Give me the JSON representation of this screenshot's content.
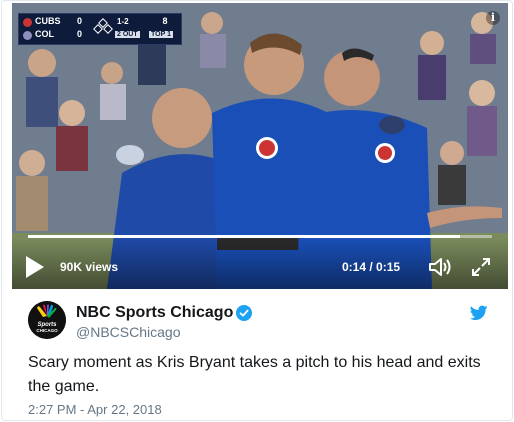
{
  "video": {
    "scorebug": {
      "away_team": "CUBS",
      "away_score": "0",
      "home_team": "COL",
      "home_score": "0",
      "count": "1-2",
      "outs": "2 OUT",
      "pitches": "8",
      "inning": "TOP 1",
      "away_color": "#cc3433",
      "home_color": "#8f8fbf"
    },
    "views": "90K views",
    "time": "0:14 / 0:15",
    "progress_fraction": 0.93,
    "icons": [
      "info-icon",
      "play-icon",
      "volume-icon",
      "fullscreen-icon"
    ]
  },
  "author": {
    "name": "NBC Sports Chicago",
    "handle": "@NBCSChicago",
    "avatar_text": "CHICAGO",
    "verified": true
  },
  "tweet": {
    "text": "Scary moment as Kris Bryant takes a pitch to his head and exits the game.",
    "timestamp": "2:27 PM - Apr 22, 2018"
  },
  "colors": {
    "twitter_blue": "#1da1f2",
    "text": "#14171a",
    "muted": "#657786",
    "cubs_blue": "#0e3386"
  }
}
